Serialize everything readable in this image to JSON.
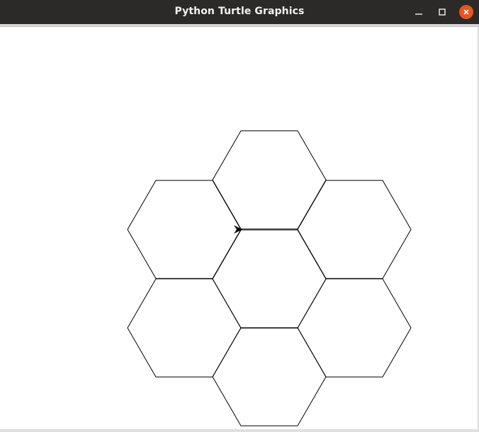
{
  "window": {
    "title": "Python Turtle Graphics"
  },
  "titlebar_buttons": {
    "minimize_icon": "minimize-icon",
    "maximize_icon": "maximize-icon",
    "close_icon": "close-icon",
    "close_color": "#e95420"
  },
  "canvas": {
    "background": "#ffffff",
    "stroke_color": "#000000",
    "hexagon_count": 7,
    "turtle_heading": "east"
  }
}
